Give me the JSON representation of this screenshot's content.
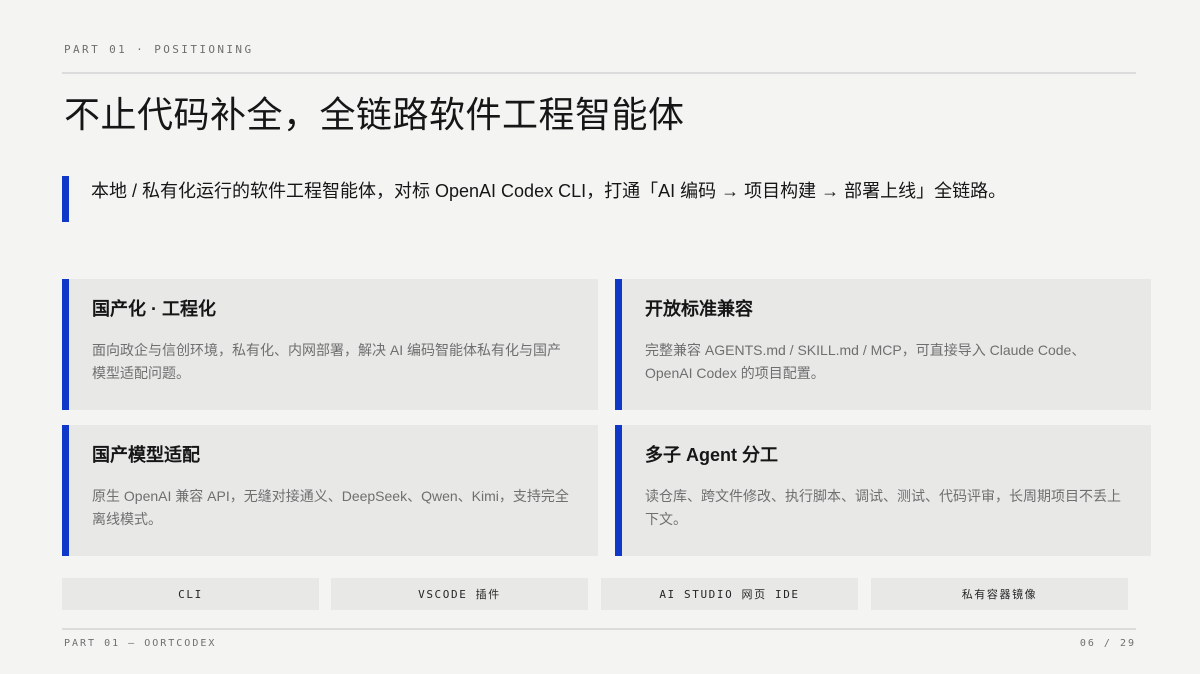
{
  "header": {
    "section_label": "PART 01 · POSITIONING",
    "title": "不止代码补全，全链路软件工程智能体"
  },
  "lead": {
    "text": "本地 / 私有化运行的软件工程智能体，对标 OpenAI Codex CLI，打通「AI 编码 → 项目构建 → 部署上线」全链路。"
  },
  "cards": [
    {
      "title": "国产化 · 工程化",
      "desc": "面向政企与信创环境，私有化、内网部署，解决 AI 编码智能体私有化与国产模型适配问题。"
    },
    {
      "title": "开放标准兼容",
      "desc": "完整兼容 AGENTS.md / SKILL.md / MCP，可直接导入 Claude Code、OpenAI Codex 的项目配置。"
    },
    {
      "title": "国产模型适配",
      "desc": "原生 OpenAI 兼容 API，无缝对接通义、DeepSeek、Qwen、Kimi，支持完全离线模式。"
    },
    {
      "title": "多子 Agent 分工",
      "desc": "读仓库、跨文件修改、执行脚本、调试、测试、代码评审，长周期项目不丢上下文。"
    }
  ],
  "chips": [
    "CLI",
    "VSCODE 插件",
    "AI STUDIO 网页 IDE",
    "私有容器镜像"
  ],
  "footer": {
    "left": "PART 01 — OORTCODEX",
    "right": "06 / 29"
  },
  "colors": {
    "accent": "#0f38c9",
    "background": "#f4f4f3",
    "card": "#e8e8e7"
  }
}
